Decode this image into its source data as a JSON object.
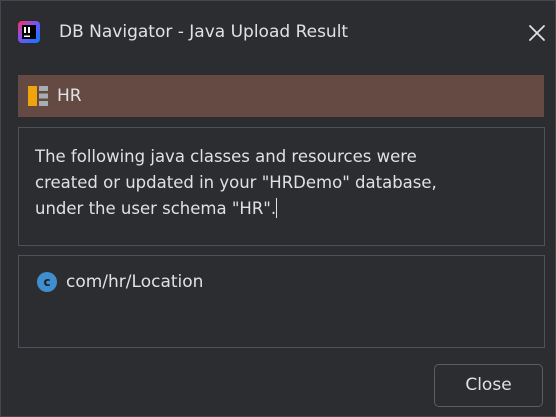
{
  "window": {
    "title": "DB Navigator - Java Upload Result",
    "app_icon": "intellij-idea-icon",
    "close_icon": "close-icon"
  },
  "schema": {
    "icon": "schema-icon",
    "label": "HR",
    "bar_color": "#654a44"
  },
  "message": {
    "line1": "The following java classes and resources were",
    "line2": "created or updated in your \"HRDemo\" database,",
    "line3": "under the user schema \"HR\"."
  },
  "results": {
    "items": [
      {
        "icon": "java-class-icon",
        "icon_letter": "c",
        "label": "com/hr/Location"
      }
    ]
  },
  "buttons": {
    "close_label": "Close"
  }
}
